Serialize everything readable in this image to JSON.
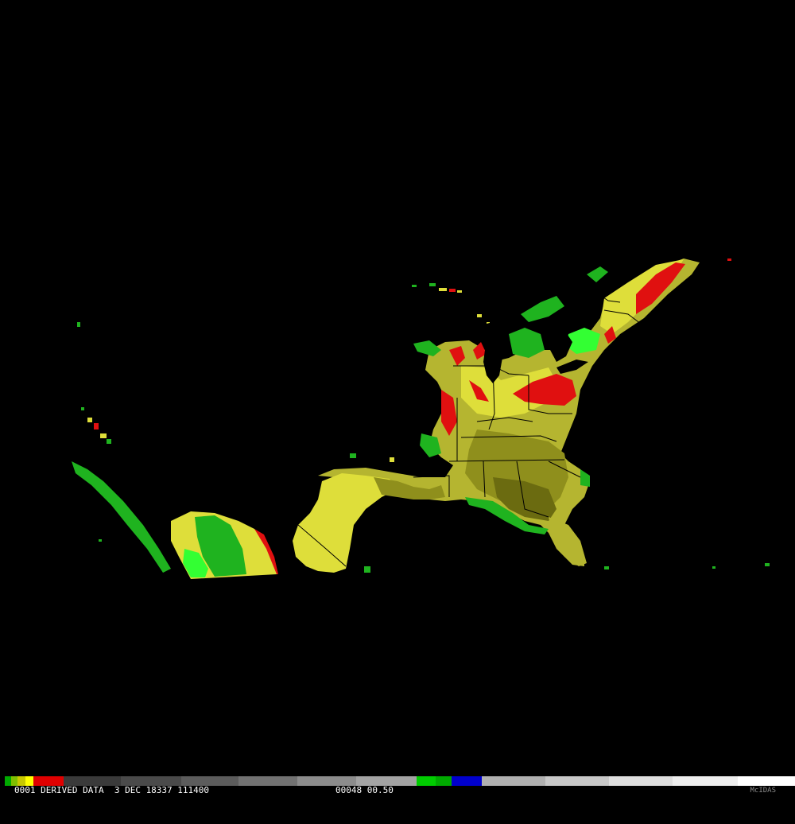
{
  "map": {
    "background": "#000000",
    "palette": {
      "dark_olive": "#6b6b10",
      "olive": "#8f8f1c",
      "khaki": "#b5b530",
      "yellow": "#dede3a",
      "bright_yellow": "#f2f23c",
      "red": "#e01010",
      "green": "#1fb31f",
      "bright_green": "#33ff33",
      "dark_green": "#1a7a1a",
      "border": "#000000"
    }
  },
  "colorbar": {
    "segments": [
      {
        "color": "#00aa00",
        "width": 8
      },
      {
        "color": "#7fbf00",
        "width": 8
      },
      {
        "color": "#c8c800",
        "width": 10
      },
      {
        "color": "#ffff00",
        "width": 10
      },
      {
        "color": "#e00000",
        "width": 38
      },
      {
        "color": "#3a3a3a",
        "width": 72
      },
      {
        "color": "#4a4a4a",
        "width": 76
      },
      {
        "color": "#5c5c5c",
        "width": 72
      },
      {
        "color": "#727272",
        "width": 74
      },
      {
        "color": "#8c8c8c",
        "width": 74
      },
      {
        "color": "#a3a3a3",
        "width": 76
      },
      {
        "color": "#00cc00",
        "width": 24
      },
      {
        "color": "#00aa00",
        "width": 20
      },
      {
        "color": "#0000cc",
        "width": 38
      },
      {
        "color": "#b0b0b0",
        "width": 80
      },
      {
        "color": "#c8c8c8",
        "width": 80
      },
      {
        "color": "#dedede",
        "width": 80
      },
      {
        "color": "#eeeeee",
        "width": 82
      },
      {
        "color": "#ffffff",
        "width": 72
      }
    ]
  },
  "info_bar": {
    "left_text": "0001 DERIVED DATA  3 DEC 18337 111400",
    "mid_text": "00048 00.50",
    "logo_text": "McIDAS"
  }
}
